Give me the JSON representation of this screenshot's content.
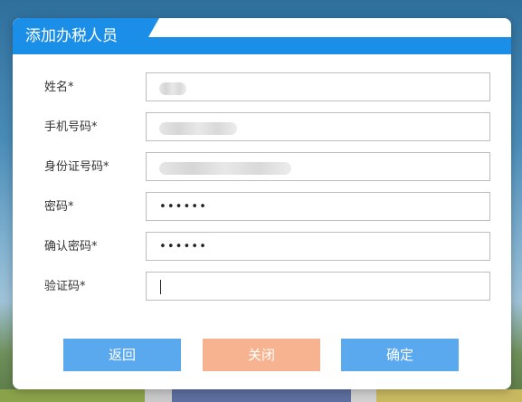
{
  "dialog": {
    "title": "添加办税人员"
  },
  "fields": [
    {
      "label": "姓名*",
      "value": "",
      "masked": true
    },
    {
      "label": "手机号码*",
      "value": "",
      "masked": true
    },
    {
      "label": "身份证号码*",
      "value": "",
      "masked": true
    },
    {
      "label": "密码*",
      "value": "••••••"
    },
    {
      "label": "确认密码*",
      "value": "••••••"
    },
    {
      "label": "验证码*",
      "value": ""
    }
  ],
  "buttons": {
    "back": "返回",
    "close": "关闭",
    "confirm": "确定"
  },
  "colors": {
    "accent": "#1b8fe8",
    "button_primary": "#5aa8ee",
    "button_close": "#f7b38f"
  }
}
